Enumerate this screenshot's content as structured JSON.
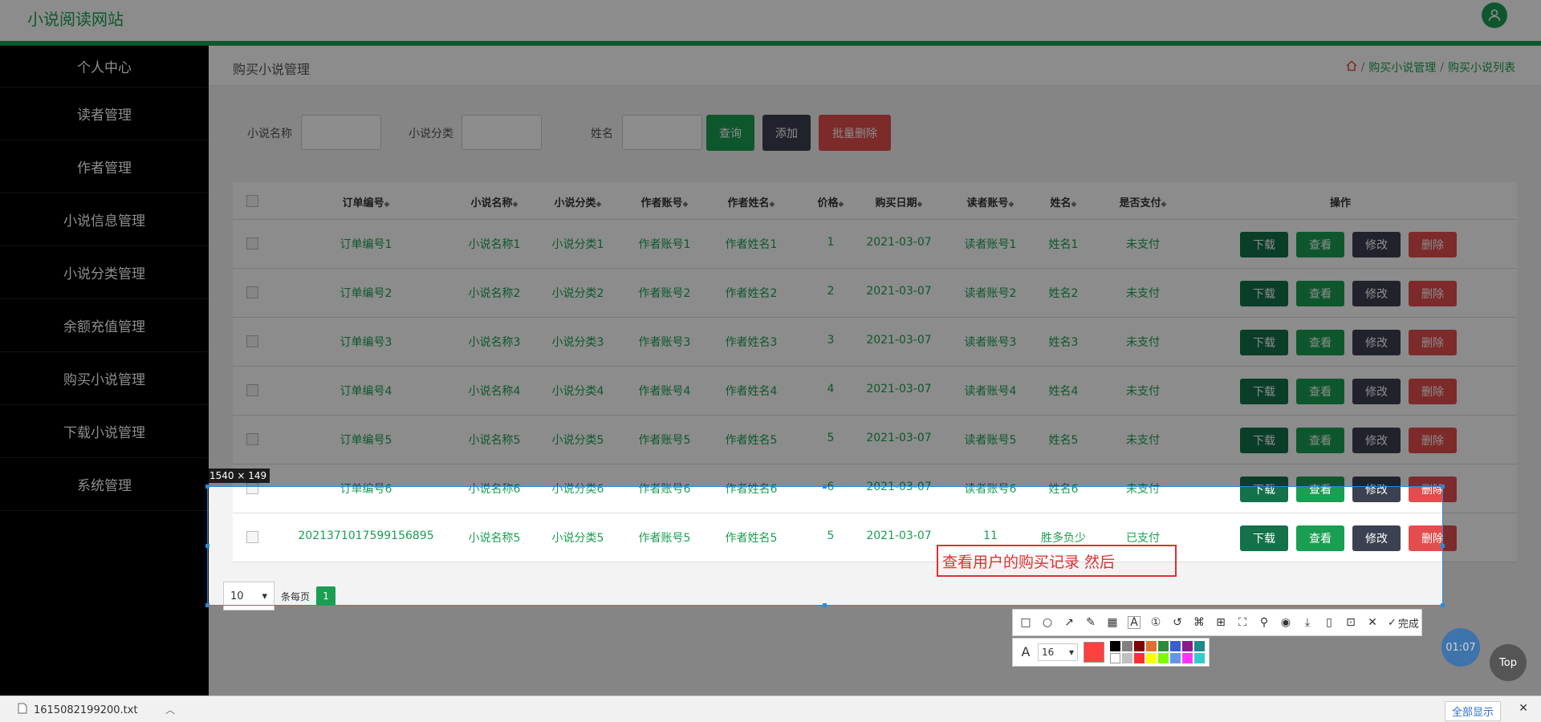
{
  "header": {
    "site_name": "小说阅读网站",
    "user_icon": "user-icon"
  },
  "sidebar": {
    "items": [
      {
        "label": "个人中心"
      },
      {
        "label": "读者管理"
      },
      {
        "label": "作者管理"
      },
      {
        "label": "小说信息管理"
      },
      {
        "label": "小说分类管理"
      },
      {
        "label": "余额充值管理"
      },
      {
        "label": "购买小说管理"
      },
      {
        "label": "下载小说管理"
      },
      {
        "label": "系统管理"
      }
    ]
  },
  "page": {
    "title": "购买小说管理",
    "breadcrumb": [
      "购买小说管理",
      "购买小说列表"
    ]
  },
  "search": {
    "novel_name_label": "小说名称",
    "novel_category_label": "小说分类",
    "name_label": "姓名",
    "query_label": "查询",
    "add_label": "添加",
    "batch_delete_label": "批量删除"
  },
  "table": {
    "headers": [
      "订单编号",
      "小说名称",
      "小说分类",
      "作者账号",
      "作者姓名",
      "价格",
      "购买日期",
      "读者账号",
      "姓名",
      "是否支付",
      "操作"
    ],
    "actions": {
      "download": "下载",
      "view": "查看",
      "edit": "修改",
      "delete": "删除"
    },
    "rows": [
      [
        "订单编号1",
        "小说名称1",
        "小说分类1",
        "作者账号1",
        "作者姓名1",
        "1",
        "2021-03-07",
        "读者账号1",
        "姓名1",
        "未支付"
      ],
      [
        "订单编号2",
        "小说名称2",
        "小说分类2",
        "作者账号2",
        "作者姓名2",
        "2",
        "2021-03-07",
        "读者账号2",
        "姓名2",
        "未支付"
      ],
      [
        "订单编号3",
        "小说名称3",
        "小说分类3",
        "作者账号3",
        "作者姓名3",
        "3",
        "2021-03-07",
        "读者账号3",
        "姓名3",
        "未支付"
      ],
      [
        "订单编号4",
        "小说名称4",
        "小说分类4",
        "作者账号4",
        "作者姓名4",
        "4",
        "2021-03-07",
        "读者账号4",
        "姓名4",
        "未支付"
      ],
      [
        "订单编号5",
        "小说名称5",
        "小说分类5",
        "作者账号5",
        "作者姓名5",
        "5",
        "2021-03-07",
        "读者账号5",
        "姓名5",
        "未支付"
      ],
      [
        "订单编号6",
        "小说名称6",
        "小说分类6",
        "作者账号6",
        "作者姓名6",
        "6",
        "2021-03-07",
        "读者账号6",
        "姓名6",
        "未支付"
      ],
      [
        "2021371017599156895",
        "小说名称5",
        "小说分类5",
        "作者账号5",
        "作者姓名5",
        "5",
        "2021-03-07",
        "11",
        "胜多负少",
        "已支付"
      ]
    ]
  },
  "pager": {
    "per_page": "10",
    "per_page_label": "条每页",
    "current_page": "1"
  },
  "capture": {
    "size_label": "1540 × 149",
    "annotation_text": "查看用户的购买记录 然后",
    "font_size": "16",
    "done_label": "完成",
    "current_color": "#ff4040",
    "palette": [
      "#000000",
      "#808080",
      "#800000",
      "#e07030",
      "#2e8b3a",
      "#3a5fcd",
      "#8b1a8b",
      "#1a8b8b",
      "#ffffff",
      "#c0c0c0",
      "#ff3030",
      "#ffff00",
      "#7cfc00",
      "#6495ed",
      "#ff33ff",
      "#33cccc"
    ]
  },
  "timer": "01:07",
  "top_button": "Top",
  "downloads": {
    "file_name": "1615082199200.txt",
    "show_all": "全部显示"
  },
  "colors": {
    "brand": "#1a9e52",
    "sidebar_bg": "#000000",
    "selection": "#2a8bd8",
    "annotation": "#e03030"
  }
}
